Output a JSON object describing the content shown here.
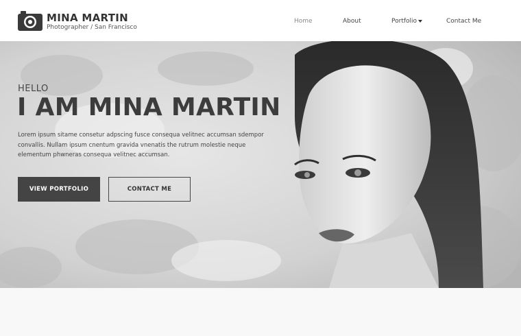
{
  "header": {
    "brand_name": "MINA MARTIN",
    "brand_tagline": "Photographer / San Francisco",
    "logo_icon": "camera-icon"
  },
  "nav": {
    "items": [
      {
        "label": "Home"
      },
      {
        "label": "About"
      },
      {
        "label": "Portfolio",
        "icon": "chevron-down-icon"
      },
      {
        "label": "Contact Me"
      }
    ]
  },
  "hero": {
    "greeting": "HELLO",
    "title": "I AM MINA MARTIN",
    "intro": "Lorem ipsum sitame consetur adpscing fusce consequa velitnec accumsan sdempor convallis. Nullam ipsum cnentum gravida vnenatis the rutrum molestie neque elementum phwneras consequa velitnec accumsan.",
    "primary_button": "VIEW PORTFOLIO",
    "secondary_button": "CONTACT ME",
    "image": "portrait-photo"
  },
  "colors": {
    "accent": "#444444",
    "header_bg": "#ffffff",
    "page_bg": "#f8f8f8"
  }
}
